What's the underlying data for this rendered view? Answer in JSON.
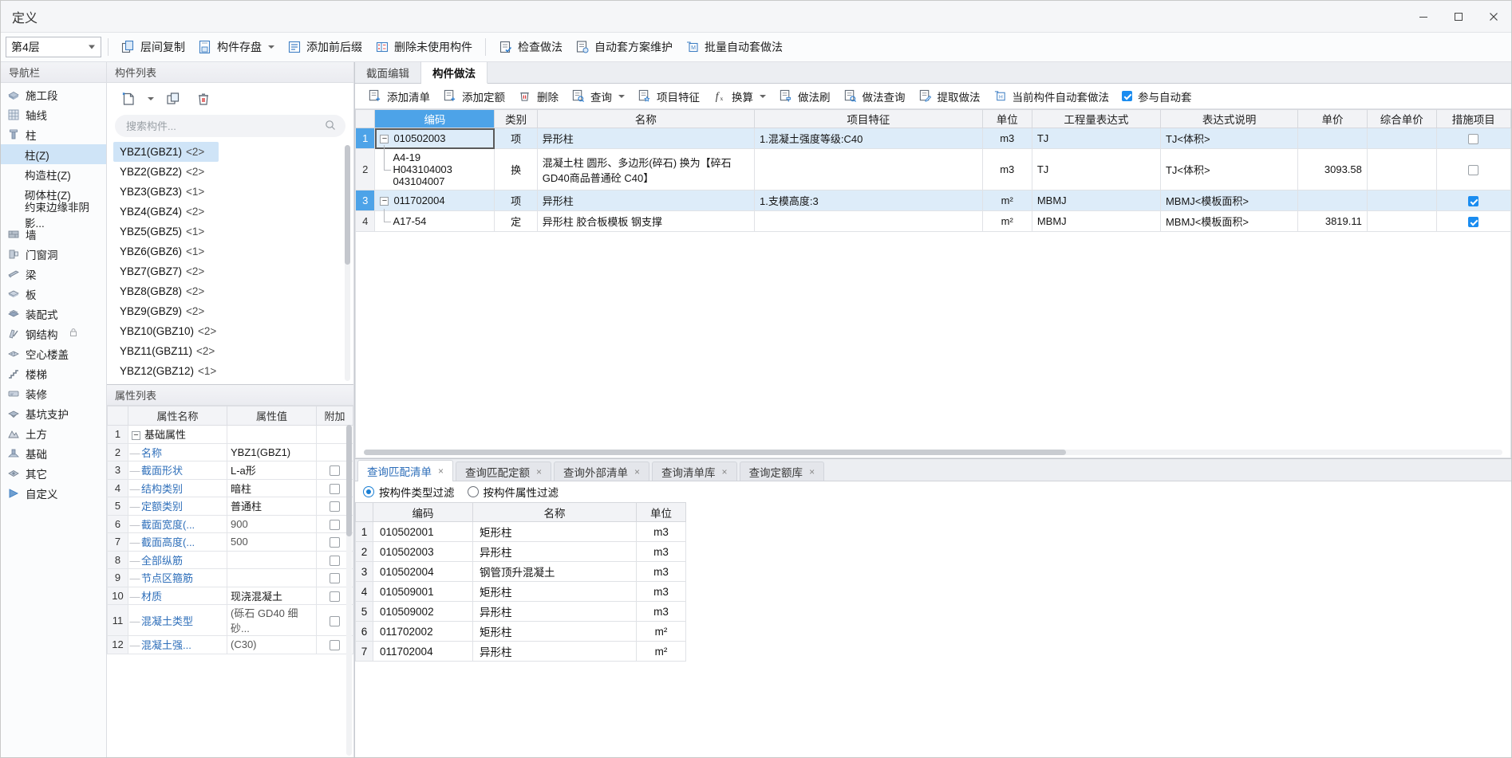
{
  "window": {
    "title": "定义",
    "minimize": "—",
    "maximize": "□",
    "close": "✕"
  },
  "toolbar": {
    "floor_value": "第4层",
    "buttons": [
      {
        "label": "层间复制",
        "icon": "copy-between-floors-icon",
        "dropdown": false
      },
      {
        "label": "构件存盘",
        "icon": "save-component-icon",
        "dropdown": true
      },
      {
        "label": "添加前后缀",
        "icon": "add-affix-icon",
        "dropdown": false
      },
      {
        "label": "删除未使用构件",
        "icon": "delete-unused-icon",
        "dropdown": false
      },
      {
        "label": "检查做法",
        "icon": "check-method-icon",
        "dropdown": false
      },
      {
        "label": "自动套方案维护",
        "icon": "auto-scheme-icon",
        "dropdown": false
      },
      {
        "label": "批量自动套做法",
        "icon": "batch-auto-icon",
        "dropdown": false
      }
    ]
  },
  "nav": {
    "header": "导航栏",
    "items": [
      {
        "label": "施工段",
        "icon": "construction-section-icon",
        "level": 0,
        "active": false,
        "locked": false
      },
      {
        "label": "轴线",
        "icon": "axis-grid-icon",
        "level": 0,
        "active": false,
        "locked": false
      },
      {
        "label": "柱",
        "icon": "column-icon",
        "level": 0,
        "active": false,
        "locked": false
      },
      {
        "label": "柱(Z)",
        "icon": "",
        "level": 1,
        "active": true,
        "locked": false
      },
      {
        "label": "构造柱(Z)",
        "icon": "",
        "level": 1,
        "active": false,
        "locked": false
      },
      {
        "label": "砌体柱(Z)",
        "icon": "",
        "level": 1,
        "active": false,
        "locked": false
      },
      {
        "label": "约束边缘非阴影...",
        "icon": "",
        "level": 1,
        "active": false,
        "locked": false
      },
      {
        "label": "墙",
        "icon": "wall-icon",
        "level": 0,
        "active": false,
        "locked": false
      },
      {
        "label": "门窗洞",
        "icon": "door-window-icon",
        "level": 0,
        "active": false,
        "locked": false
      },
      {
        "label": "梁",
        "icon": "beam-icon",
        "level": 0,
        "active": false,
        "locked": false
      },
      {
        "label": "板",
        "icon": "slab-icon",
        "level": 0,
        "active": false,
        "locked": false
      },
      {
        "label": "装配式",
        "icon": "prefab-icon",
        "level": 0,
        "active": false,
        "locked": false
      },
      {
        "label": "钢结构",
        "icon": "steel-structure-icon",
        "level": 0,
        "active": false,
        "locked": true
      },
      {
        "label": "空心楼盖",
        "icon": "hollow-floor-icon",
        "level": 0,
        "active": false,
        "locked": false
      },
      {
        "label": "楼梯",
        "icon": "stairs-icon",
        "level": 0,
        "active": false,
        "locked": false
      },
      {
        "label": "装修",
        "icon": "decoration-icon",
        "level": 0,
        "active": false,
        "locked": false
      },
      {
        "label": "基坑支护",
        "icon": "pit-support-icon",
        "level": 0,
        "active": false,
        "locked": false
      },
      {
        "label": "土方",
        "icon": "earthwork-icon",
        "level": 0,
        "active": false,
        "locked": false
      },
      {
        "label": "基础",
        "icon": "foundation-icon",
        "level": 0,
        "active": false,
        "locked": false
      },
      {
        "label": "其它",
        "icon": "other-icon",
        "level": 0,
        "active": false,
        "locked": false
      },
      {
        "label": "自定义",
        "icon": "custom-icon",
        "level": 0,
        "active": false,
        "locked": false
      }
    ]
  },
  "component_list": {
    "header": "构件列表",
    "tools": [
      {
        "name": "new-component-icon",
        "label": ""
      },
      {
        "name": "copy-component-icon",
        "label": ""
      },
      {
        "name": "delete-component-icon",
        "label": ""
      }
    ],
    "search_placeholder": "搜索构件...",
    "items": [
      {
        "label": "YBZ1(GBZ1)",
        "count": "<2>",
        "selected": true
      },
      {
        "label": "YBZ2(GBZ2)",
        "count": "<2>",
        "selected": false
      },
      {
        "label": "YBZ3(GBZ3)",
        "count": "<1>",
        "selected": false
      },
      {
        "label": "YBZ4(GBZ4)",
        "count": "<2>",
        "selected": false
      },
      {
        "label": "YBZ5(GBZ5)",
        "count": "<1>",
        "selected": false
      },
      {
        "label": "YBZ6(GBZ6)",
        "count": "<1>",
        "selected": false
      },
      {
        "label": "YBZ7(GBZ7)",
        "count": "<2>",
        "selected": false
      },
      {
        "label": "YBZ8(GBZ8)",
        "count": "<2>",
        "selected": false
      },
      {
        "label": "YBZ9(GBZ9)",
        "count": "<2>",
        "selected": false
      },
      {
        "label": "YBZ10(GBZ10)",
        "count": "<2>",
        "selected": false
      },
      {
        "label": "YBZ11(GBZ11)",
        "count": "<2>",
        "selected": false
      },
      {
        "label": "YBZ12(GBZ12)",
        "count": "<1>",
        "selected": false
      }
    ]
  },
  "property_list": {
    "header": "属性列表",
    "columns": [
      "",
      "属性名称",
      "属性值",
      "附加"
    ],
    "rows": [
      {
        "idx": "1",
        "name": "基础属性",
        "value": "",
        "group": true,
        "attach": null
      },
      {
        "idx": "2",
        "name": "名称",
        "value": "YBZ1(GBZ1)",
        "group": false,
        "attach": null
      },
      {
        "idx": "3",
        "name": "截面形状",
        "value": "L-a形",
        "group": false,
        "attach": false
      },
      {
        "idx": "4",
        "name": "结构类别",
        "value": "暗柱",
        "group": false,
        "attach": false
      },
      {
        "idx": "5",
        "name": "定额类别",
        "value": "普通柱",
        "group": false,
        "attach": false
      },
      {
        "idx": "6",
        "name": "截面宽度(...",
        "value": "900",
        "group": false,
        "attach": false
      },
      {
        "idx": "7",
        "name": "截面高度(...",
        "value": "500",
        "group": false,
        "attach": false
      },
      {
        "idx": "8",
        "name": "全部纵筋",
        "value": "",
        "group": false,
        "attach": false
      },
      {
        "idx": "9",
        "name": "节点区箍筋",
        "value": "",
        "group": false,
        "attach": false
      },
      {
        "idx": "10",
        "name": "材质",
        "value": "现浇混凝土",
        "group": false,
        "attach": false
      },
      {
        "idx": "11",
        "name": "混凝土类型",
        "value": "(砾石 GD40 细砂...",
        "group": false,
        "attach": false
      },
      {
        "idx": "12",
        "name": "混凝土强...",
        "value": "(C30)",
        "group": false,
        "attach": false
      }
    ]
  },
  "main": {
    "tabs": [
      {
        "label": "截面编辑",
        "active": false
      },
      {
        "label": "构件做法",
        "active": true
      }
    ],
    "toolbar": [
      {
        "label": "添加清单",
        "icon": "add-list-icon",
        "dropdown": false
      },
      {
        "label": "添加定额",
        "icon": "add-quota-icon",
        "dropdown": false
      },
      {
        "label": "删除",
        "icon": "delete-icon",
        "dropdown": false
      },
      {
        "label": "查询",
        "icon": "query-icon",
        "dropdown": true
      },
      {
        "label": "项目特征",
        "icon": "project-feature-icon",
        "dropdown": false
      },
      {
        "label": "换算",
        "icon": "convert-icon",
        "dropdown": true
      },
      {
        "label": "做法刷",
        "icon": "method-brush-icon",
        "dropdown": false
      },
      {
        "label": "做法查询",
        "icon": "method-query-icon",
        "dropdown": false
      },
      {
        "label": "提取做法",
        "icon": "extract-method-icon",
        "dropdown": false
      },
      {
        "label": "当前构件自动套做法",
        "icon": "auto-apply-icon",
        "dropdown": false
      }
    ],
    "auto_checkbox": {
      "label": "参与自动套",
      "checked": true
    },
    "columns": [
      {
        "label": "编码",
        "selected": true
      },
      {
        "label": "类别",
        "selected": false
      },
      {
        "label": "名称",
        "selected": false
      },
      {
        "label": "项目特征",
        "selected": false
      },
      {
        "label": "单位",
        "selected": false
      },
      {
        "label": "工程量表达式",
        "selected": false
      },
      {
        "label": "表达式说明",
        "selected": false
      },
      {
        "label": "单价",
        "selected": false
      },
      {
        "label": "综合单价",
        "selected": false
      },
      {
        "label": "措施项目",
        "selected": false
      }
    ],
    "rows": [
      {
        "idx": "1",
        "code": "010502003",
        "code_lines": [
          "010502003"
        ],
        "expandable": true,
        "child": false,
        "category": "项",
        "name": "异形柱",
        "feature": "1.混凝土强度等级:C40",
        "unit": "m3",
        "expr": "TJ",
        "expr_desc": "TJ<体积>",
        "price": "",
        "total_price": "",
        "measure": false,
        "highlight": true,
        "focus": true
      },
      {
        "idx": "2",
        "code": "",
        "code_lines": [
          "A4-19",
          "H043104003",
          "043104007"
        ],
        "expandable": false,
        "child": true,
        "category": "换",
        "name": "混凝土柱 圆形、多边形(碎石) 换为【碎石 GD40商品普通砼 C40】",
        "feature": "",
        "unit": "m3",
        "expr": "TJ",
        "expr_desc": "TJ<体积>",
        "price": "3093.58",
        "total_price": "",
        "measure": false,
        "highlight": false,
        "focus": false
      },
      {
        "idx": "3",
        "code": "011702004",
        "code_lines": [
          "011702004"
        ],
        "expandable": true,
        "child": false,
        "category": "项",
        "name": "异形柱",
        "feature": "1.支模高度:3",
        "unit": "m²",
        "expr": "MBMJ",
        "expr_desc": "MBMJ<模板面积>",
        "price": "",
        "total_price": "",
        "measure": true,
        "highlight": true,
        "focus": false
      },
      {
        "idx": "4",
        "code": "",
        "code_lines": [
          "A17-54"
        ],
        "expandable": false,
        "child": true,
        "category": "定",
        "name": "异形柱 胶合板模板 钢支撑",
        "feature": "",
        "unit": "m²",
        "expr": "MBMJ",
        "expr_desc": "MBMJ<模板面积>",
        "price": "3819.11",
        "total_price": "",
        "measure": true,
        "highlight": false,
        "focus": false
      }
    ]
  },
  "query_panel": {
    "tabs": [
      {
        "label": "查询匹配清单",
        "active": true,
        "close": "×"
      },
      {
        "label": "查询匹配定额",
        "active": false,
        "close": "×"
      },
      {
        "label": "查询外部清单",
        "active": false,
        "close": "×"
      },
      {
        "label": "查询清单库",
        "active": false,
        "close": "×"
      },
      {
        "label": "查询定额库",
        "active": false,
        "close": "×"
      }
    ],
    "filters": [
      {
        "label": "按构件类型过滤",
        "checked": true
      },
      {
        "label": "按构件属性过滤",
        "checked": false
      }
    ],
    "columns": [
      "",
      "编码",
      "名称",
      "单位"
    ],
    "rows": [
      {
        "idx": "1",
        "code": "010502001",
        "name": "矩形柱",
        "unit": "m3"
      },
      {
        "idx": "2",
        "code": "010502003",
        "name": "异形柱",
        "unit": "m3"
      },
      {
        "idx": "3",
        "code": "010502004",
        "name": "钢管顶升混凝土",
        "unit": "m3"
      },
      {
        "idx": "4",
        "code": "010509001",
        "name": "矩形柱",
        "unit": "m3"
      },
      {
        "idx": "5",
        "code": "010509002",
        "name": "异形柱",
        "unit": "m3"
      },
      {
        "idx": "6",
        "code": "011702002",
        "name": "矩形柱",
        "unit": "m²"
      },
      {
        "idx": "7",
        "code": "011702004",
        "name": "异形柱",
        "unit": "m²"
      }
    ]
  },
  "colors": {
    "accent": "#1a7fd4",
    "header_select": "#4da3e8",
    "row_highlight": "#ddecf9",
    "nav_active": "#cfe4f7",
    "link": "#2f6fba"
  }
}
